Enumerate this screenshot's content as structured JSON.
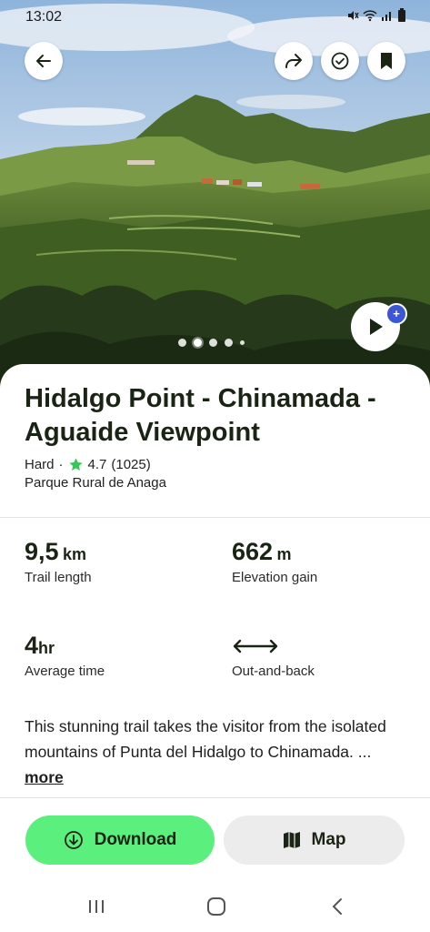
{
  "status": {
    "time": "13:02"
  },
  "hero": {
    "photo_count": 5,
    "active_index": 1
  },
  "trail": {
    "title": "Hidalgo Point - Chinamada - Aguaide Viewpoint",
    "difficulty": "Hard",
    "separator": "·",
    "rating": "4.7",
    "review_count": "(1025)",
    "region": "Parque Rural de Anaga"
  },
  "stats": {
    "length_value": "9,5",
    "length_unit": "km",
    "length_label": "Trail length",
    "elevation_value": "662",
    "elevation_unit": "m",
    "elevation_label": "Elevation gain",
    "time_value": "4",
    "time_unit": "hr",
    "time_label": "Average time",
    "route_type_label": "Out-and-back"
  },
  "description": {
    "text": "This stunning trail takes the visitor from the isolated mountains of Punta del Hidalgo to Chinamada. ...",
    "more_label": "more"
  },
  "actions": {
    "download_label": "Download",
    "map_label": "Map"
  },
  "colors": {
    "download_bg": "#5bf07d",
    "map_bg": "#ececec",
    "star": "#35c75a",
    "badge": "#3c56d6"
  },
  "icons": [
    "back-arrow-icon",
    "share-icon",
    "check-circle-icon",
    "bookmark-icon",
    "play-icon",
    "star-icon",
    "download-icon",
    "map-icon",
    "two-way-arrow-icon"
  ]
}
